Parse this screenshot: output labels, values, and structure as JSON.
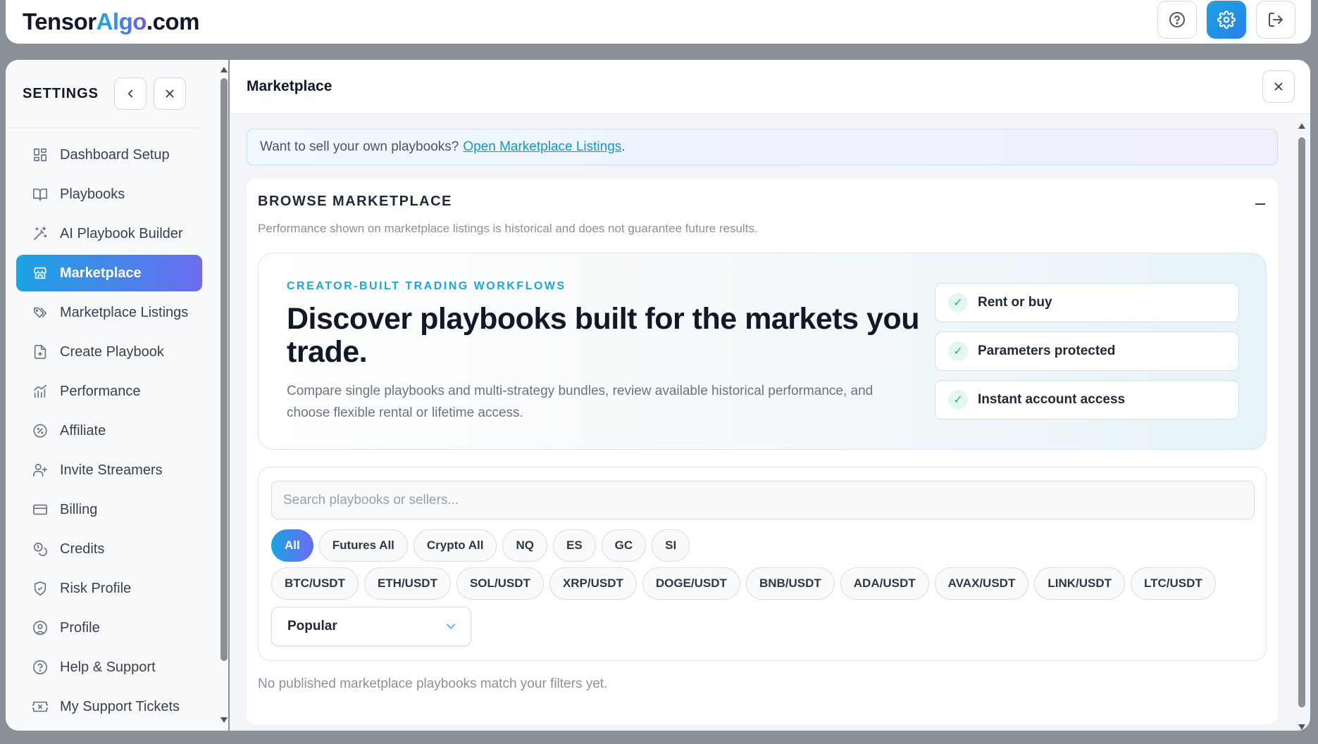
{
  "header": {
    "logo_part1": "Tensor",
    "logo_part2": "Algo",
    "logo_part3": ".com"
  },
  "sidebar": {
    "title": "SETTINGS",
    "items": [
      {
        "label": "Dashboard Setup",
        "icon": "layout-grid-icon"
      },
      {
        "label": "Playbooks",
        "icon": "book-open-icon"
      },
      {
        "label": "AI Playbook Builder",
        "icon": "magic-wand-icon"
      },
      {
        "label": "Marketplace",
        "icon": "store-icon",
        "active": true
      },
      {
        "label": "Marketplace Listings",
        "icon": "tags-icon"
      },
      {
        "label": "Create Playbook",
        "icon": "file-plus-icon"
      },
      {
        "label": "Performance",
        "icon": "chart-icon"
      },
      {
        "label": "Affiliate",
        "icon": "badge-percent-icon"
      },
      {
        "label": "Invite Streamers",
        "icon": "user-plus-icon"
      },
      {
        "label": "Billing",
        "icon": "credit-card-icon"
      },
      {
        "label": "Credits",
        "icon": "coins-icon"
      },
      {
        "label": "Risk Profile",
        "icon": "shield-check-icon"
      },
      {
        "label": "Profile",
        "icon": "user-circle-icon"
      },
      {
        "label": "Help & Support",
        "icon": "help-circle-icon"
      },
      {
        "label": "My Support Tickets",
        "icon": "ticket-icon"
      }
    ]
  },
  "main": {
    "title": "Marketplace",
    "banner": {
      "text": "Want to sell your own playbooks?",
      "link": "Open Marketplace Listings",
      "suffix": "."
    },
    "browse": {
      "heading": "BROWSE MARKETPLACE",
      "disclaimer": "Performance shown on marketplace listings is historical and does not guarantee future results."
    },
    "hero": {
      "kicker": "CREATOR-BUILT TRADING WORKFLOWS",
      "headline": "Discover playbooks built for the markets you trade.",
      "description": "Compare single playbooks and multi-strategy bundles, review available historical performance, and choose flexible rental or lifetime access.",
      "features": [
        "Rent or buy",
        "Parameters protected",
        "Instant account access"
      ]
    },
    "filters": {
      "search_placeholder": "Search playbooks or sellers...",
      "chips_row1": [
        "All",
        "Futures All",
        "Crypto All",
        "NQ",
        "ES",
        "GC",
        "SI"
      ],
      "chips_row2": [
        "BTC/USDT",
        "ETH/USDT",
        "SOL/USDT",
        "XRP/USDT",
        "DOGE/USDT",
        "BNB/USDT",
        "ADA/USDT",
        "AVAX/USDT",
        "LINK/USDT",
        "LTC/USDT"
      ],
      "active_chip": "All",
      "sort_value": "Popular"
    },
    "empty_message": "No published marketplace playbooks match your filters yet."
  }
}
